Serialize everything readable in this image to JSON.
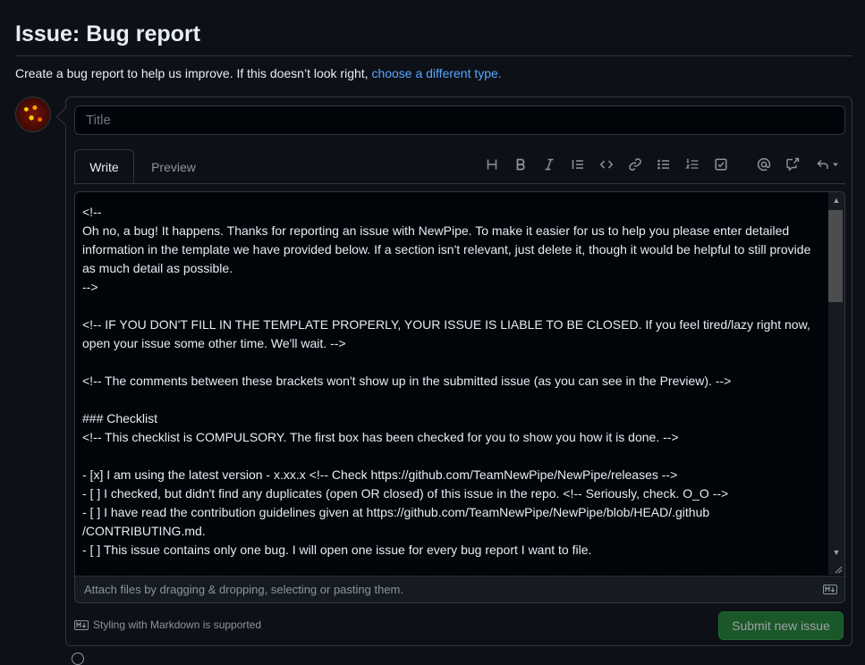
{
  "page": {
    "title": "Issue: Bug report",
    "subtitle_text": "Create a bug report to help us improve. If this doesn’t look right, ",
    "subtitle_link": "choose a different type."
  },
  "form": {
    "title_placeholder": "Title",
    "tabs": [
      {
        "label": "Write",
        "active": true
      },
      {
        "label": "Preview",
        "active": false
      }
    ],
    "toolbar_icons": [
      "heading-icon",
      "bold-icon",
      "italic-icon",
      "quote-icon",
      "code-icon",
      "link-icon",
      "bulleted-list-icon",
      "numbered-list-icon",
      "task-list-icon",
      "mention-icon",
      "cross-reference-icon",
      "reply-icon"
    ],
    "body_lines": [
      "<!--",
      "Oh no, a bug! It happens. Thanks for reporting an issue with NewPipe. To make it easier for us to help you please enter detailed information in the template we have provided below. If a section isn't relevant, just delete it, though it would be helpful to still provide as much detail as possible.",
      "-->",
      "",
      "<!-- IF YOU DON'T FILL IN THE TEMPLATE PROPERLY, YOUR ISSUE IS LIABLE TO BE CLOSED. If you feel tired/lazy right now, open your issue some other time. We'll wait. -->",
      "",
      "<!-- The comments between these brackets won't show up in the submitted issue (as you can see in the Preview). -->",
      "",
      "### Checklist",
      "<!-- This checklist is COMPULSORY. The first box has been checked for you to show you how it is done. -->",
      "",
      "- [x] I am using the latest version - x.xx.x <!-- Check https://github.com/TeamNewPipe/NewPipe/releases -->",
      "- [ ] I checked, but didn't find any duplicates (open OR closed) of this issue in the repo. <!-- Seriously, check. O_O -->",
      "- [ ] I have read the contribution guidelines given at https://github.com/TeamNewPipe/NewPipe/blob/HEAD/.github\n/CONTRIBUTING.md.",
      "- [ ] This issue contains only one bug. I will open one issue for every bug report I want to file."
    ],
    "attach_text": "Attach files by dragging & dropping, selecting or pasting them.",
    "markdown_hint": "Styling with Markdown is supported",
    "submit_label": "Submit new issue"
  },
  "colors": {
    "background": "#0d1117",
    "link": "#58a6ff",
    "submit": "#238636"
  }
}
